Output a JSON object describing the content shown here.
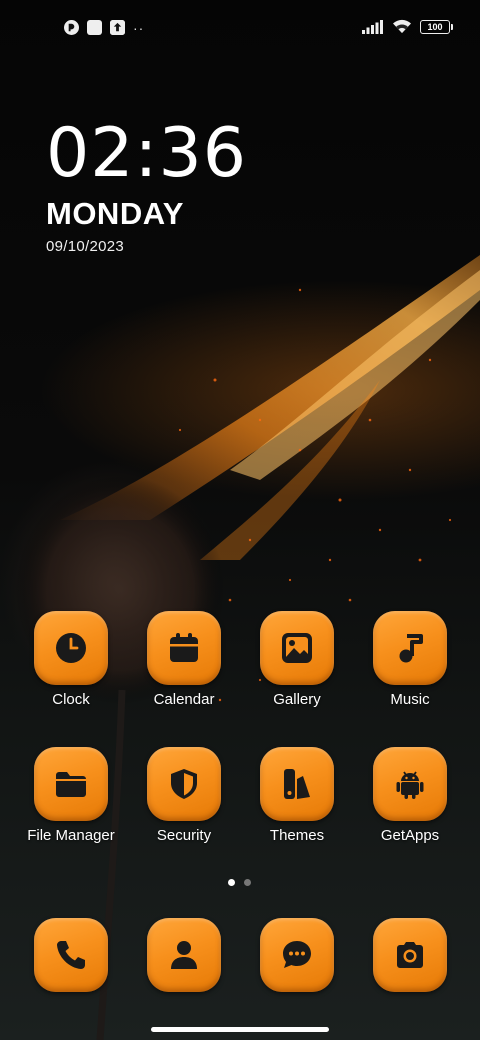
{
  "status_bar": {
    "left_icons": [
      "app-notification-icon",
      "square-notification-icon",
      "upload-notification-icon"
    ],
    "more_indicator": "··",
    "battery_level": "100",
    "signal": "signal-icon",
    "wifi": "wifi-icon"
  },
  "clock_widget": {
    "time": "02:36",
    "day": "MONDAY",
    "date": "09/10/2023"
  },
  "apps": [
    {
      "label": "Clock",
      "icon": "clock-icon"
    },
    {
      "label": "Calendar",
      "icon": "calendar-icon"
    },
    {
      "label": "Gallery",
      "icon": "gallery-icon"
    },
    {
      "label": "Music",
      "icon": "music-note-icon"
    },
    {
      "label": "File Manager",
      "icon": "folder-icon"
    },
    {
      "label": "Security",
      "icon": "shield-icon"
    },
    {
      "label": "Themes",
      "icon": "themes-icon"
    },
    {
      "label": "GetApps",
      "icon": "android-icon"
    }
  ],
  "pager": {
    "pages": 2,
    "current": 1
  },
  "dock": [
    {
      "icon": "phone-icon"
    },
    {
      "icon": "contacts-icon"
    },
    {
      "icon": "messages-icon"
    },
    {
      "icon": "camera-icon"
    }
  ],
  "colors": {
    "tile": "#f7901c",
    "glyph": "#1a1a1a"
  }
}
